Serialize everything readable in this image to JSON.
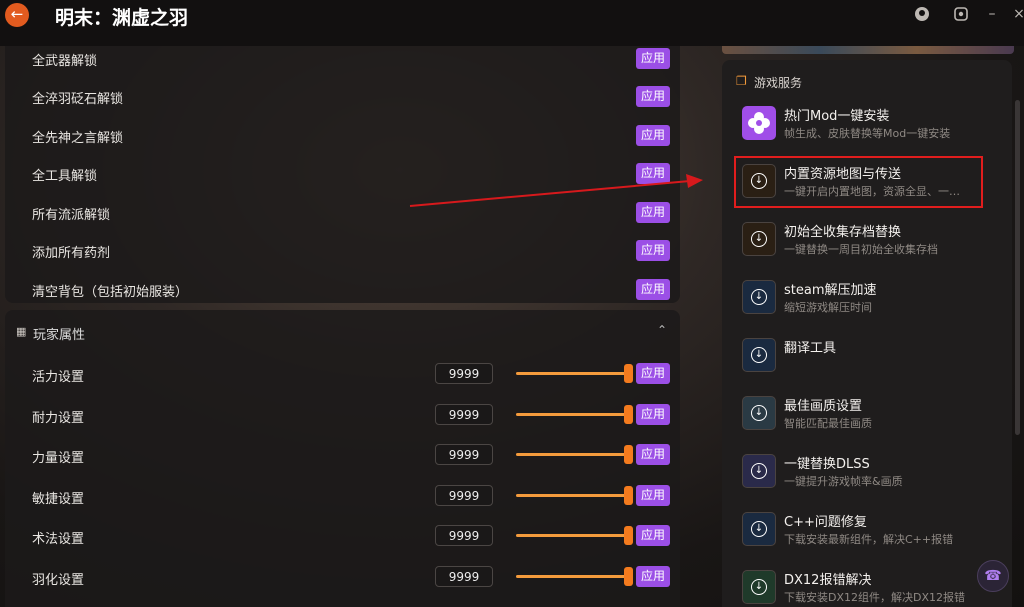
{
  "app": {
    "title": "明末：渊虚之羽",
    "back_icon": "back-arrow-icon"
  },
  "accent": {
    "apply": "#9b4fe6",
    "slider": "#f49b3c",
    "highlight": "#e11d1d"
  },
  "unlock_section": {
    "apply_label": "应用",
    "items": [
      "全武器解锁",
      "全淬羽砭石解锁",
      "全先神之言解锁",
      "全工具解锁",
      "所有流派解锁",
      "添加所有药剂",
      "清空背包（包括初始服装）"
    ]
  },
  "player_section": {
    "title": "玩家属性",
    "apply_label": "应用",
    "stats": [
      {
        "label": "活力设置",
        "value": "9999",
        "slider_level": 1.0
      },
      {
        "label": "耐力设置",
        "value": "9999",
        "slider_level": 1.0
      },
      {
        "label": "力量设置",
        "value": "9999",
        "slider_level": 1.0
      },
      {
        "label": "敏捷设置",
        "value": "9999",
        "slider_level": 1.0
      },
      {
        "label": "术法设置",
        "value": "9999",
        "slider_level": 1.0
      },
      {
        "label": "羽化设置",
        "value": "9999",
        "slider_level": 1.0
      }
    ]
  },
  "services": {
    "title": "游戏服务",
    "items": [
      {
        "title": "热门Mod一键安装",
        "desc": "帧生成、皮肤替换等Mod一键安装",
        "icon": "mod-flower-icon"
      },
      {
        "title": "内置资源地图与传送",
        "desc": "一键开启内置地图，资源全显、一…",
        "icon": "download-icon"
      },
      {
        "title": "初始全收集存档替换",
        "desc": "一键替换一周目初始全收集存档",
        "icon": "download-icon"
      },
      {
        "title": "steam解压加速",
        "desc": "缩短游戏解压时间",
        "icon": "download-icon"
      },
      {
        "title": "翻译工具",
        "desc": "",
        "icon": "download-icon"
      },
      {
        "title": "最佳画质设置",
        "desc": "智能匹配最佳画质",
        "icon": "download-icon"
      },
      {
        "title": "一键替换DLSS",
        "desc": "一键提升游戏帧率&画质",
        "icon": "download-icon"
      },
      {
        "title": "C++问题修复",
        "desc": "下载安装最新组件，解决C++报错",
        "icon": "download-icon"
      },
      {
        "title": "DX12报错解决",
        "desc": "下载安装DX12组件，解决DX12报错",
        "icon": "download-icon"
      }
    ]
  }
}
